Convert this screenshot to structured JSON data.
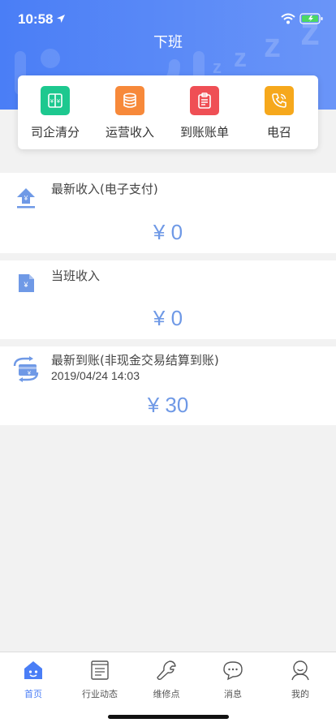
{
  "status_bar": {
    "time": "10:58"
  },
  "header": {
    "title": "下班"
  },
  "quick_actions": [
    {
      "label": "司企清分",
      "icon": "settlement-icon",
      "color": "#1dc88f"
    },
    {
      "label": "运营收入",
      "icon": "database-icon",
      "color": "#f7893a"
    },
    {
      "label": "到账账单",
      "icon": "clipboard-icon",
      "color": "#ef4f55"
    },
    {
      "label": "电召",
      "icon": "phone-icon",
      "color": "#f6a81c"
    }
  ],
  "sections": {
    "latest_income": {
      "title": "最新收入(电子支付)",
      "amount": "¥ 0"
    },
    "shift_income": {
      "title": "当班收入",
      "amount": "¥ 0"
    },
    "latest_arrival": {
      "title": "最新到账(非现金交易结算到账)",
      "date": "2019/04/24 14:03",
      "amount": "¥ 30"
    }
  },
  "tabbar": {
    "items": [
      {
        "label": "首页",
        "icon": "home-icon",
        "active": true
      },
      {
        "label": "行业动态",
        "icon": "news-icon",
        "active": false
      },
      {
        "label": "维修点",
        "icon": "wrench-icon",
        "active": false
      },
      {
        "label": "消息",
        "icon": "chat-icon",
        "active": false
      },
      {
        "label": "我的",
        "icon": "user-icon",
        "active": false
      }
    ]
  },
  "colors": {
    "primary": "#4a7ef6",
    "amount": "#6f99e6"
  }
}
